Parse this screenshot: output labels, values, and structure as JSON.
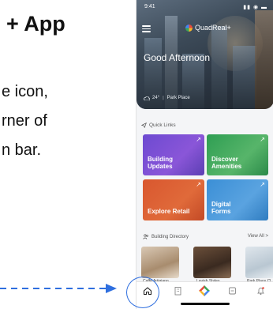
{
  "slide": {
    "title": "+ App",
    "line1": "e icon,",
    "line2": "rner of",
    "line3": "n bar."
  },
  "phone": {
    "status_time": "9:41",
    "status_icons": "▮▮ ◉ ▬",
    "logo_text": "QuadReal+",
    "greeting": "Good Afternoon",
    "temperature": "24°",
    "location": "Park Place",
    "quick_links_label": "Quick Links",
    "tiles": [
      {
        "label": "Building Updates"
      },
      {
        "label": "Discover Amenities"
      },
      {
        "label": "Explore Retail"
      },
      {
        "label": "Digital Forms"
      }
    ],
    "tile_corner_glyph": "↗",
    "directory_label": "Building Directory",
    "view_all": "View All  >",
    "directory_items": [
      "Caffe Artigiano",
      "Lavish Styles",
      "Park Place Cl"
    ]
  },
  "colors": {
    "accent": "#2f6fdf",
    "tile_building_updates": "#7a4fd6",
    "tile_discover_amenities": "#3aa65a",
    "tile_explore_retail": "#dc5f33",
    "tile_digital_forms": "#4a98dc"
  },
  "icons": {
    "nav": [
      "home-icon",
      "building-icon",
      "app-logo-icon",
      "tools-icon",
      "bell-icon"
    ]
  }
}
